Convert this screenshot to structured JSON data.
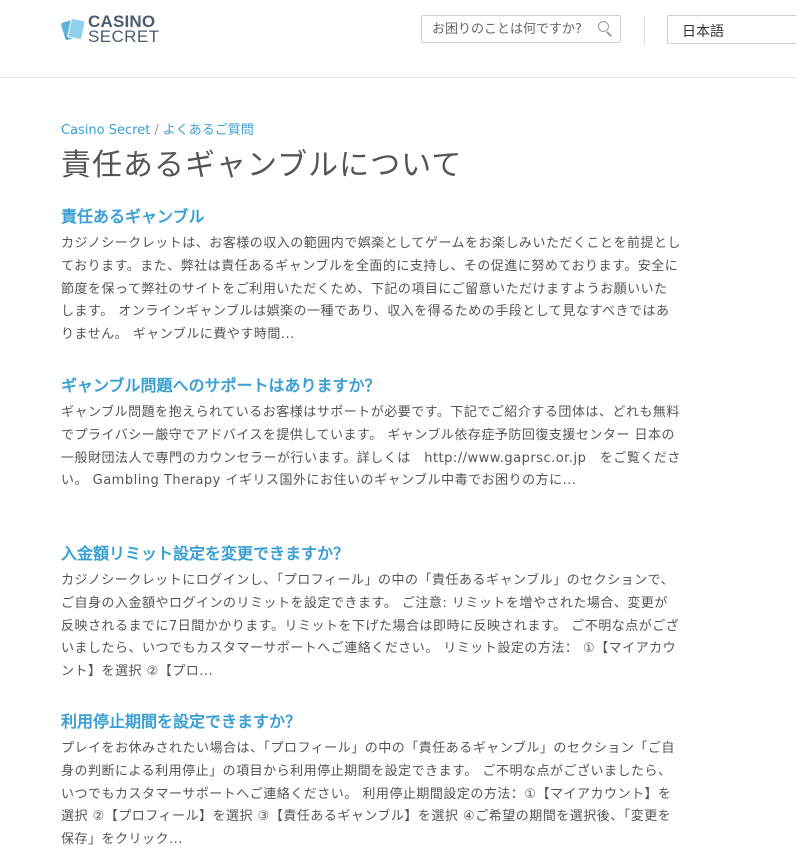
{
  "header": {
    "logo_top": "CASINO",
    "logo_bottom": "SECRET",
    "search_placeholder": "お困りのことは何ですか?",
    "language": "日本語"
  },
  "breadcrumb": {
    "home": "Casino Secret",
    "separator": "/",
    "current": "よくあるご質問"
  },
  "page_title": "責任あるギャンブルについて",
  "articles": [
    {
      "title": "責任あるギャンブル",
      "body": "カジノシークレットは、お客様の収入の範囲内で娯楽としてゲームをお楽しみいただくことを前提としております。また、弊社は責任あるギャンブルを全面的に支持し、その促進に努めております。安全に節度を保って弊社のサイトをご利用いただくため、下記の項目にご留意いただけますようお願いいたします。 オンラインギャンブルは娯楽の一種であり、収入を得るための手段として見なすべきではありません。 ギャンブルに費やす時間..."
    },
    {
      "title": "ギャンブル問題へのサポートはありますか？",
      "body": "ギャンブル問題を抱えられているお客様はサポートが必要です。下記でご紹介する団体は、どれも無料でプライバシー厳守でアドバイスを提供しています。 ギャンブル依存症予防回復支援センター 日本の一般財団法人で専門のカウンセラーが行います。詳しくは　http://www.gaprsc.or.jp　をご覧ください。 Gambling Therapy イギリス国外にお住いのギャンブル中毒でお困りの方に..."
    },
    {
      "title": "入金額リミット設定を変更できますか？",
      "body": "カジノシークレットにログインし、「プロフィール」の中の「責任あるギャンブル」のセクションで、ご自身の入金額やログインのリミットを設定できます。 ご注意: リミットを増やされた場合、変更が反映されるまでに7日間かかります。リミットを下げた場合は即時に反映されます。 ご不明な点がございましたら、いつでもカスタマーサポートへご連絡ください。 リミット設定の方法： ①【マイアカウント】を選択 ②【プロ..."
    },
    {
      "title": "利用停止期間を設定できますか？",
      "body": "プレイをお休みされたい場合は、「プロフィール」の中の「責任あるギャンブル」のセクション「ご自身の判断による利用停止」の項目から利用停止期間を設定できます。 ご不明な点がございましたら、いつでもカスタマーサポートへご連絡ください。 利用停止期間設定の方法：①【マイアカウント】を選択 ②【プロフィール】を選択 ③【責任あるギャンブル】を選択 ④ご希望の期間を選択後、「変更を保存」をクリック..."
    }
  ]
}
